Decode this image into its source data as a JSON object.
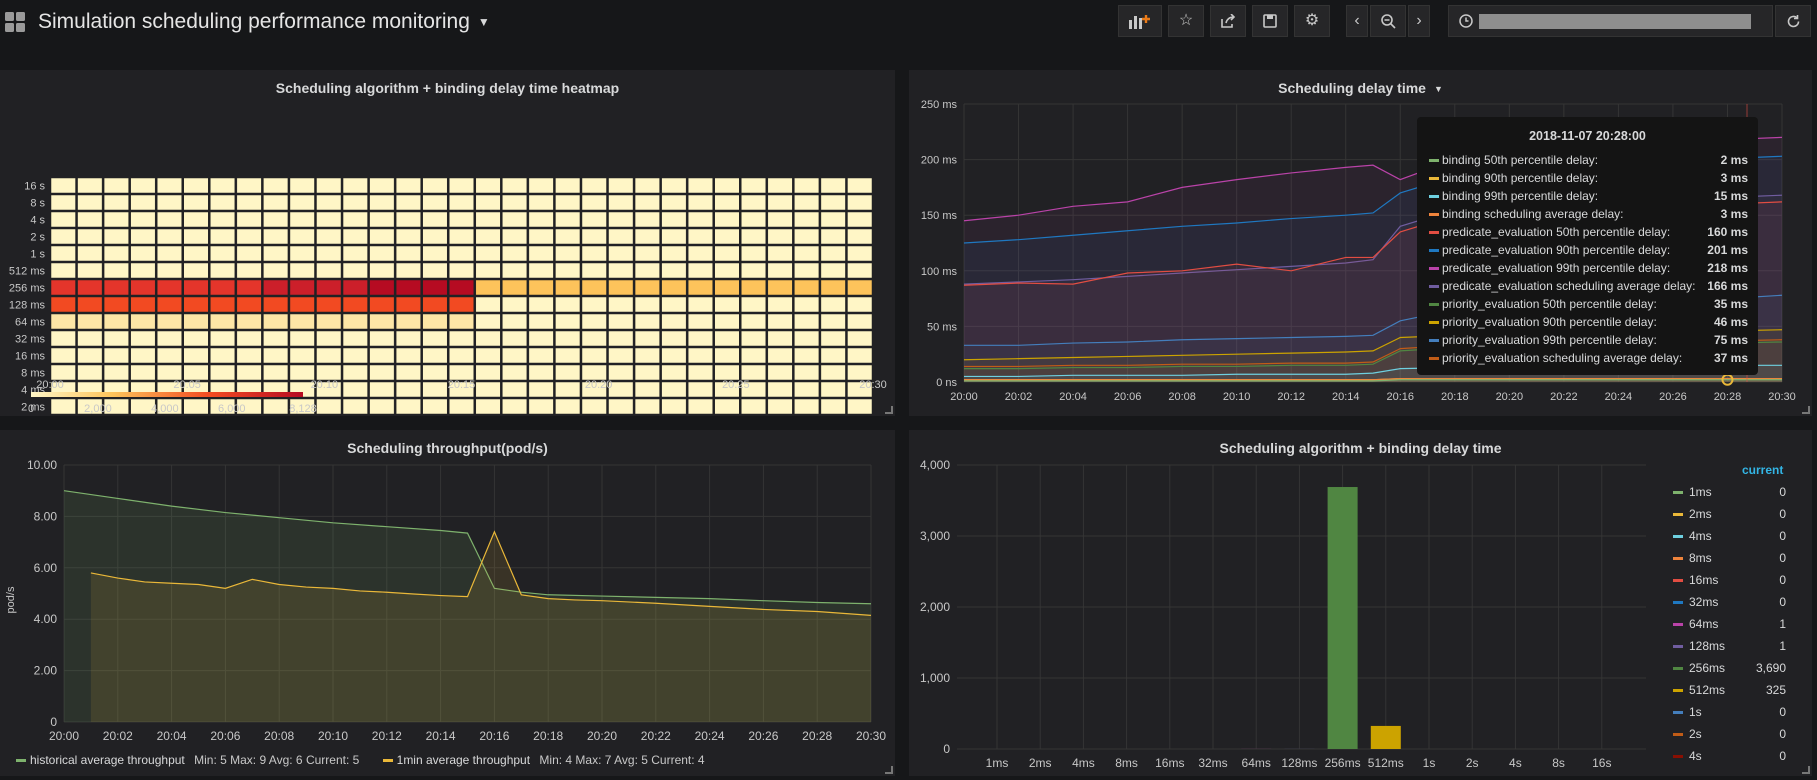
{
  "dashboard": {
    "title": "Simulation scheduling performance monitoring"
  },
  "toolbar": {
    "add_panel_icon": "add-panel-icon",
    "star_icon": "star-icon",
    "share_icon": "share-icon",
    "save_icon": "save-icon",
    "settings_icon": "gear-icon",
    "prev_icon": "chevron-left-icon",
    "zoom_icon": "zoom-out-icon",
    "next_icon": "chevron-right-icon",
    "clock_icon": "clock-icon",
    "refresh_icon": "refresh-icon"
  },
  "panels": {
    "heatmap": {
      "title": "Scheduling algorithm + binding delay time heatmap",
      "y_labels": [
        "16 s",
        "8 s",
        "4 s",
        "2 s",
        "1 s",
        "512 ms",
        "256 ms",
        "128 ms",
        "64 ms",
        "32 ms",
        "16 ms",
        "8 ms",
        "4 ms",
        "2 ms",
        "1 ms"
      ],
      "x_labels": [
        "20:00",
        "20:05",
        "20:10",
        "20:15",
        "20:20",
        "20:25",
        "20:30"
      ],
      "color_scale_labels": [
        "0",
        "2,000",
        "4,000",
        "6,000",
        "8,128"
      ],
      "colors": {
        "low": "#fff6c6",
        "mid1": "#fdc35b",
        "mid2": "#f44d22",
        "high": "#b60b22"
      }
    },
    "delay": {
      "title": "Scheduling delay time",
      "y_labels": [
        "250 ms",
        "200 ms",
        "150 ms",
        "100 ms",
        "50 ms",
        "0 ns"
      ],
      "x_labels": [
        "20:00",
        "20:02",
        "20:04",
        "20:06",
        "20:08",
        "20:10",
        "20:12",
        "20:14",
        "20:16",
        "20:18",
        "20:20",
        "20:22",
        "20:24",
        "20:26",
        "20:28",
        "20:30"
      ],
      "tooltip": {
        "time": "2018-11-07 20:28:00",
        "rows": [
          {
            "name": "binding 50th percentile delay:",
            "value": "2 ms",
            "color": "#7eb26d"
          },
          {
            "name": "binding 90th percentile delay:",
            "value": "3 ms",
            "color": "#eab839"
          },
          {
            "name": "binding 99th percentile delay:",
            "value": "15 ms",
            "color": "#6ed0e0"
          },
          {
            "name": "binding scheduling average delay:",
            "value": "3 ms",
            "color": "#ef843c"
          },
          {
            "name": "predicate_evaluation 50th percentile delay:",
            "value": "160 ms",
            "color": "#e24d42"
          },
          {
            "name": "predicate_evaluation 90th percentile delay:",
            "value": "201 ms",
            "color": "#1f78c1"
          },
          {
            "name": "predicate_evaluation 99th percentile delay:",
            "value": "218 ms",
            "color": "#ba43a9"
          },
          {
            "name": "predicate_evaluation scheduling average delay:",
            "value": "166 ms",
            "color": "#705da0"
          },
          {
            "name": "priority_evaluation 50th percentile delay:",
            "value": "35 ms",
            "color": "#508642"
          },
          {
            "name": "priority_evaluation 90th percentile delay:",
            "value": "46 ms",
            "color": "#cca300"
          },
          {
            "name": "priority_evaluation 99th percentile delay:",
            "value": "75 ms",
            "color": "#447ebc"
          },
          {
            "name": "priority_evaluation scheduling average delay:",
            "value": "37 ms",
            "color": "#c15c17"
          }
        ]
      }
    },
    "throughput": {
      "title": "Scheduling throughput(pod/s)",
      "y_title": "pod/s",
      "y_labels": [
        "10.00",
        "8.00",
        "6.00",
        "4.00",
        "2.00",
        "0"
      ],
      "x_labels": [
        "20:00",
        "20:02",
        "20:04",
        "20:06",
        "20:08",
        "20:10",
        "20:12",
        "20:14",
        "20:16",
        "20:18",
        "20:20",
        "20:22",
        "20:24",
        "20:26",
        "20:28",
        "20:30"
      ],
      "legend": [
        {
          "name": "historical average throughput",
          "stats": "Min: 5   Max: 9   Avg: 6   Current: 5",
          "color": "#7eb26d"
        },
        {
          "name": "1min average throughput",
          "stats": "Min: 4   Max: 7   Avg: 5   Current: 4",
          "color": "#eab839"
        }
      ]
    },
    "bars": {
      "title": "Scheduling algorithm + binding delay time",
      "legend_header": "current",
      "y_labels": [
        "4,000",
        "3,000",
        "2,000",
        "1,000",
        "0"
      ],
      "legend": [
        {
          "name": "1ms",
          "value": "0",
          "color": "#7eb26d"
        },
        {
          "name": "2ms",
          "value": "0",
          "color": "#eab839"
        },
        {
          "name": "4ms",
          "value": "0",
          "color": "#6ed0e0"
        },
        {
          "name": "8ms",
          "value": "0",
          "color": "#ef843c"
        },
        {
          "name": "16ms",
          "value": "0",
          "color": "#e24d42"
        },
        {
          "name": "32ms",
          "value": "0",
          "color": "#1f78c1"
        },
        {
          "name": "64ms",
          "value": "1",
          "color": "#ba43a9"
        },
        {
          "name": "128ms",
          "value": "1",
          "color": "#705da0"
        },
        {
          "name": "256ms",
          "value": "3,690",
          "color": "#508642"
        },
        {
          "name": "512ms",
          "value": "325",
          "color": "#cca300"
        },
        {
          "name": "1s",
          "value": "0",
          "color": "#447ebc"
        },
        {
          "name": "2s",
          "value": "0",
          "color": "#c15c17"
        },
        {
          "name": "4s",
          "value": "0",
          "color": "#890f02"
        }
      ]
    }
  },
  "chart_data": [
    {
      "type": "heatmap",
      "title": "Scheduling algorithm + binding delay time heatmap",
      "y_buckets": [
        "1 ms",
        "2 ms",
        "4 ms",
        "8 ms",
        "16 ms",
        "32 ms",
        "64 ms",
        "128 ms",
        "256 ms",
        "512 ms",
        "1 s",
        "2 s",
        "4 s",
        "8 s",
        "16 s"
      ],
      "x_range": [
        "20:00",
        "20:30"
      ],
      "color_range": [
        0,
        8128
      ],
      "hot_buckets": {
        "256 ms": "high (about 5,500 rising toward 8,128) from 20:00 to 20:16, then low (about 2,000) to 20:30",
        "128 ms": "about 5,500 from 20:00 to 20:16, then about 0",
        "64 ms": "about 1,500 from 20:00 to 20:16, then about 0"
      }
    },
    {
      "type": "area",
      "title": "Scheduling delay time",
      "x": [
        "20:00",
        "20:02",
        "20:04",
        "20:06",
        "20:08",
        "20:10",
        "20:12",
        "20:14",
        "20:15",
        "20:16",
        "20:18",
        "20:20",
        "20:22",
        "20:24",
        "20:26",
        "20:28",
        "20:30"
      ],
      "ylim": [
        0,
        250
      ],
      "series": [
        {
          "name": "predicate_evaluation 99th percentile delay",
          "values": [
            145,
            150,
            158,
            162,
            175,
            182,
            188,
            193,
            195,
            182,
            200,
            205,
            208,
            210,
            215,
            218,
            220
          ]
        },
        {
          "name": "predicate_evaluation 90th percentile delay",
          "values": [
            125,
            128,
            132,
            136,
            140,
            143,
            147,
            150,
            152,
            170,
            185,
            190,
            193,
            195,
            198,
            201,
            203
          ]
        },
        {
          "name": "predicate_evaluation scheduling average delay",
          "values": [
            88,
            90,
            92,
            95,
            98,
            101,
            104,
            107,
            110,
            140,
            155,
            158,
            160,
            162,
            164,
            166,
            168
          ]
        },
        {
          "name": "predicate_evaluation 50th percentile delay",
          "values": [
            87,
            89,
            88,
            98,
            100,
            106,
            100,
            112,
            112,
            135,
            150,
            153,
            155,
            157,
            158,
            160,
            162
          ]
        },
        {
          "name": "priority_evaluation 99th percentile delay",
          "values": [
            33,
            33,
            35,
            36,
            38,
            39,
            40,
            41,
            42,
            55,
            65,
            68,
            70,
            72,
            73,
            75,
            78
          ]
        },
        {
          "name": "priority_evaluation 90th percentile delay",
          "values": [
            20,
            21,
            22,
            23,
            24,
            25,
            26,
            27,
            28,
            40,
            42,
            43,
            44,
            45,
            45,
            46,
            47
          ]
        },
        {
          "name": "priority_evaluation scheduling average delay",
          "values": [
            14,
            14,
            15,
            15,
            16,
            16,
            17,
            17,
            18,
            30,
            33,
            34,
            35,
            36,
            36,
            37,
            38
          ]
        },
        {
          "name": "priority_evaluation 50th percentile delay",
          "values": [
            12,
            12,
            13,
            13,
            14,
            14,
            15,
            15,
            16,
            28,
            31,
            32,
            33,
            34,
            34,
            35,
            36
          ]
        },
        {
          "name": "binding 99th percentile delay",
          "values": [
            5,
            5,
            6,
            6,
            6,
            7,
            7,
            7,
            8,
            12,
            13,
            13,
            14,
            14,
            15,
            15,
            15
          ]
        },
        {
          "name": "binding 90th percentile delay",
          "values": [
            2,
            2,
            2,
            2,
            2,
            2,
            2,
            2,
            2,
            3,
            3,
            3,
            3,
            3,
            3,
            3,
            3
          ]
        },
        {
          "name": "binding scheduling average delay",
          "values": [
            2,
            2,
            2,
            2,
            2,
            2,
            2,
            2,
            2,
            3,
            3,
            3,
            3,
            3,
            3,
            3,
            3
          ]
        },
        {
          "name": "binding 50th percentile delay",
          "values": [
            1,
            1,
            1,
            1,
            1,
            1,
            1,
            1,
            1,
            2,
            2,
            2,
            2,
            2,
            2,
            2,
            2
          ]
        }
      ]
    },
    {
      "type": "area",
      "title": "Scheduling throughput(pod/s)",
      "ylabel": "pod/s",
      "ylim": [
        0,
        10
      ],
      "series": [
        {
          "name": "historical average throughput",
          "x": [
            "20:00",
            "20:02",
            "20:04",
            "20:06",
            "20:08",
            "20:10",
            "20:12",
            "20:14",
            "20:15",
            "20:16",
            "20:17",
            "20:18",
            "20:20",
            "20:22",
            "20:24",
            "20:26",
            "20:28",
            "20:30"
          ],
          "values": [
            9.0,
            8.7,
            8.4,
            8.15,
            7.95,
            7.75,
            7.6,
            7.45,
            7.35,
            5.2,
            5.05,
            4.95,
            4.9,
            4.85,
            4.8,
            4.72,
            4.65,
            4.6
          ]
        },
        {
          "name": "1min average throughput",
          "x": [
            "20:01",
            "20:02",
            "20:03",
            "20:04",
            "20:05",
            "20:06",
            "20:07",
            "20:08",
            "20:09",
            "20:10",
            "20:11",
            "20:12",
            "20:13",
            "20:14",
            "20:15",
            "20:16",
            "20:17",
            "20:18",
            "20:19",
            "20:20",
            "20:22",
            "20:24",
            "20:26",
            "20:28",
            "20:30"
          ],
          "values": [
            5.8,
            5.6,
            5.45,
            5.4,
            5.35,
            5.2,
            5.55,
            5.35,
            5.25,
            5.2,
            5.1,
            5.05,
            4.98,
            4.92,
            4.88,
            7.4,
            4.95,
            4.8,
            4.75,
            4.72,
            4.62,
            4.5,
            4.38,
            4.3,
            4.15
          ]
        }
      ]
    },
    {
      "type": "bar",
      "title": "Scheduling algorithm + binding delay time",
      "categories": [
        "1ms",
        "2ms",
        "4ms",
        "8ms",
        "16ms",
        "32ms",
        "64ms",
        "128ms",
        "256ms",
        "512ms",
        "1s",
        "2s",
        "4s",
        "8s",
        "16s"
      ],
      "values": [
        0,
        0,
        0,
        0,
        0,
        0,
        1,
        1,
        3690,
        325,
        0,
        0,
        0,
        0,
        0
      ],
      "ylim": [
        0,
        4000
      ]
    }
  ]
}
